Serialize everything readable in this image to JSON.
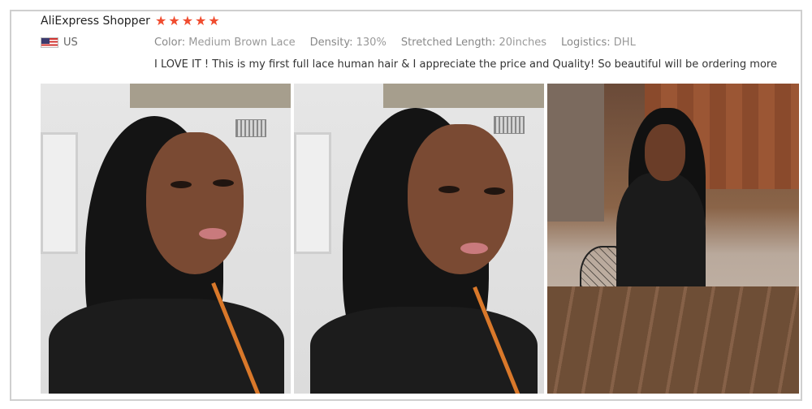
{
  "review": {
    "reviewer": "AliExpress Shopper",
    "rating": 5,
    "country_code": "US",
    "attributes": [
      {
        "key": "Color:",
        "value": "Medium Brown Lace"
      },
      {
        "key": "Density:",
        "value": "130%"
      },
      {
        "key": "Stretched Length:",
        "value": "20inches"
      },
      {
        "key": "Logistics:",
        "value": "DHL"
      }
    ],
    "text": "I LOVE IT ! This is my first full lace human hair & I appreciate the price and Quality! So beautiful will be ordering more"
  },
  "photos": [
    {
      "icon": "photo-selfie-closeup"
    },
    {
      "icon": "photo-selfie-closeup"
    },
    {
      "icon": "photo-seated-outdoor"
    }
  ],
  "colors": {
    "star": "#f04c2f",
    "border": "#cfcfcf"
  }
}
